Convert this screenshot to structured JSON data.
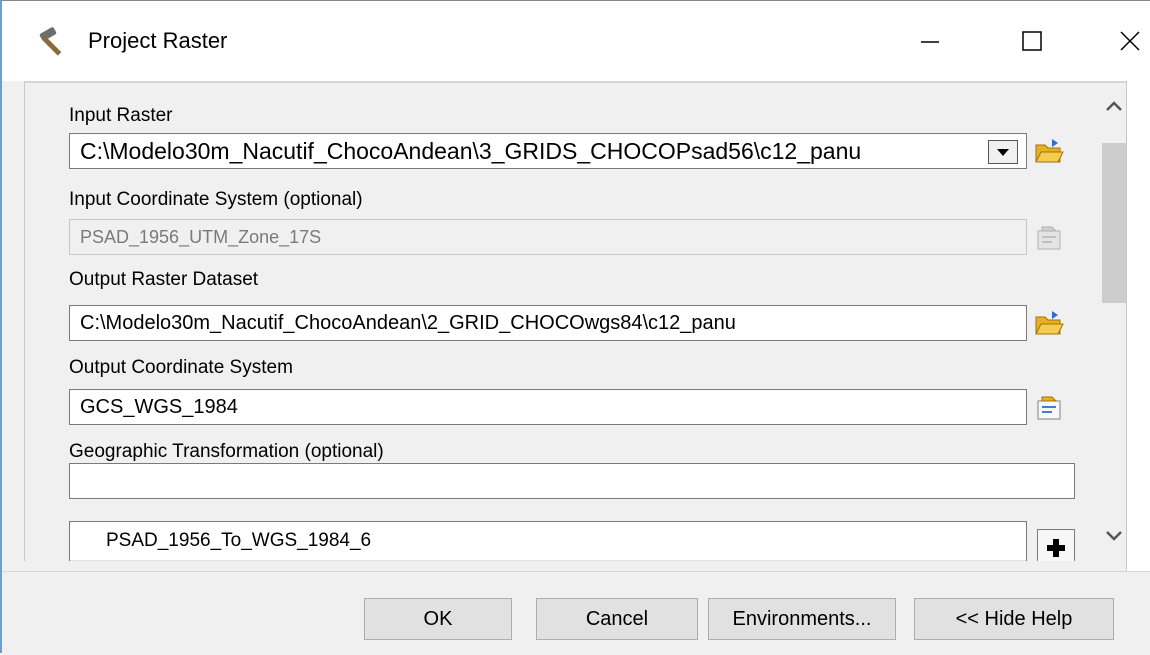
{
  "window": {
    "title": "Project Raster",
    "icon": "hammer-icon"
  },
  "form": {
    "input_raster": {
      "label": "Input Raster",
      "value": "C:\\Modelo30m_Nacutif_ChocoAndean\\3_GRIDS_CHOCOPsad56\\c12_panu"
    },
    "input_coord": {
      "label": "Input Coordinate System (optional)",
      "value": "PSAD_1956_UTM_Zone_17S"
    },
    "output_raster": {
      "label": "Output Raster Dataset",
      "value": "C:\\Modelo30m_Nacutif_ChocoAndean\\2_GRID_CHOCOwgs84\\c12_panu"
    },
    "output_coord": {
      "label": "Output Coordinate System",
      "value": "GCS_WGS_1984"
    },
    "geo_transform": {
      "label": "Geographic Transformation (optional)",
      "value": "",
      "items": [
        "PSAD_1956_To_WGS_1984_6"
      ]
    }
  },
  "buttons": {
    "ok": "OK",
    "cancel": "Cancel",
    "environments": "Environments...",
    "hide_help": "<< Hide Help"
  },
  "colors": {
    "folder": "#e8b020",
    "accent_border": "#6aa0d0"
  }
}
